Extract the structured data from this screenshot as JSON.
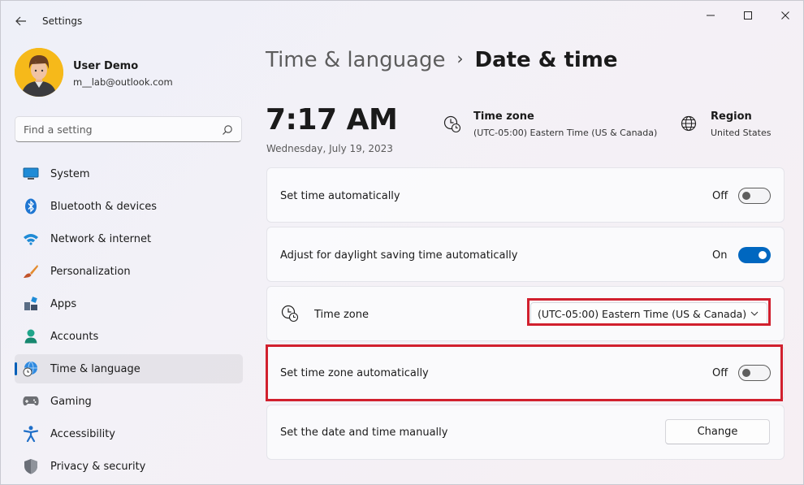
{
  "window": {
    "title": "Settings"
  },
  "profile": {
    "name": "User Demo",
    "email": "m__lab@outlook.com"
  },
  "search": {
    "placeholder": "Find a setting"
  },
  "sidebar": {
    "items": [
      {
        "label": "System",
        "icon": "monitor-icon",
        "selected": false
      },
      {
        "label": "Bluetooth & devices",
        "icon": "bluetooth-icon",
        "selected": false
      },
      {
        "label": "Network & internet",
        "icon": "wifi-icon",
        "selected": false
      },
      {
        "label": "Personalization",
        "icon": "brush-icon",
        "selected": false
      },
      {
        "label": "Apps",
        "icon": "apps-icon",
        "selected": false
      },
      {
        "label": "Accounts",
        "icon": "person-icon",
        "selected": false
      },
      {
        "label": "Time & language",
        "icon": "globe-clock-icon",
        "selected": true
      },
      {
        "label": "Gaming",
        "icon": "gamepad-icon",
        "selected": false
      },
      {
        "label": "Accessibility",
        "icon": "accessibility-icon",
        "selected": false
      },
      {
        "label": "Privacy & security",
        "icon": "shield-icon",
        "selected": false
      }
    ]
  },
  "breadcrumb": {
    "parent": "Time & language",
    "separator": "›",
    "current": "Date & time"
  },
  "clock": {
    "time": "7:17 AM",
    "date": "Wednesday, July 19, 2023"
  },
  "summary": {
    "timezone": {
      "title": "Time zone",
      "value": "(UTC-05:00) Eastern Time (US & Canada)"
    },
    "region": {
      "title": "Region",
      "value": "United States"
    }
  },
  "settings": {
    "set_time_auto": {
      "label": "Set time automatically",
      "state": "Off"
    },
    "daylight_saving": {
      "label": "Adjust for daylight saving time automatically",
      "state": "On"
    },
    "time_zone": {
      "label": "Time zone",
      "selected": "(UTC-05:00) Eastern Time (US & Canada)"
    },
    "set_tz_auto": {
      "label": "Set time zone automatically",
      "state": "Off"
    },
    "manual": {
      "label": "Set the date and time manually",
      "button": "Change"
    }
  },
  "colors": {
    "accent": "#0067c0",
    "highlight": "#d1202e",
    "selection_bar": "#005fb8"
  }
}
